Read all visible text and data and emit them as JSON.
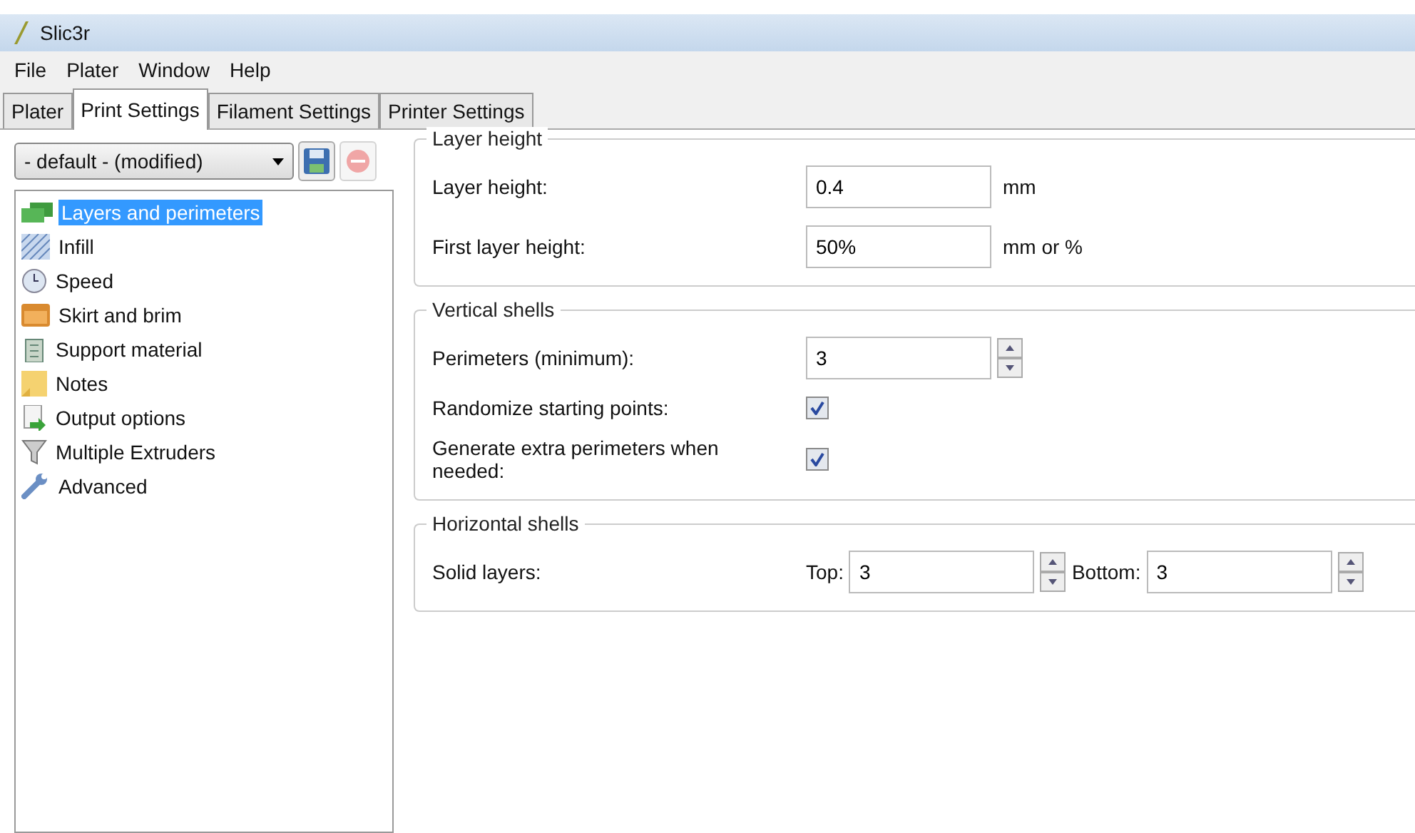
{
  "window": {
    "title": "Slic3r"
  },
  "menu": [
    "File",
    "Plater",
    "Window",
    "Help"
  ],
  "tabs": [
    {
      "label": "Plater",
      "selected": false
    },
    {
      "label": "Print Settings",
      "selected": true
    },
    {
      "label": "Filament Settings",
      "selected": false
    },
    {
      "label": "Printer Settings",
      "selected": false
    }
  ],
  "preset": {
    "value": "- default - (modified)",
    "delete_disabled": true
  },
  "sidebar": {
    "items": [
      {
        "label": "Layers and perimeters",
        "selected": true
      },
      {
        "label": "Infill",
        "selected": false
      },
      {
        "label": "Speed",
        "selected": false
      },
      {
        "label": "Skirt and brim",
        "selected": false
      },
      {
        "label": "Support material",
        "selected": false
      },
      {
        "label": "Notes",
        "selected": false
      },
      {
        "label": "Output options",
        "selected": false
      },
      {
        "label": "Multiple Extruders",
        "selected": false
      },
      {
        "label": "Advanced",
        "selected": false
      }
    ]
  },
  "groups": [
    {
      "title": "Layer height",
      "rows": [
        {
          "kind": "text",
          "label": "Layer height:",
          "value": "0.4",
          "unit": "mm"
        },
        {
          "kind": "text",
          "label": "First layer height:",
          "value": "50%",
          "unit": "mm or %"
        }
      ]
    },
    {
      "title": "Vertical shells",
      "rows": [
        {
          "kind": "spin",
          "label": "Perimeters (minimum):",
          "value": "3"
        },
        {
          "kind": "checkbox",
          "label": "Randomize starting points:",
          "checked": true
        },
        {
          "kind": "checkbox",
          "label": "Generate extra perimeters when needed:",
          "checked": true
        }
      ]
    },
    {
      "title": "Horizontal shells",
      "rows": [
        {
          "kind": "pair",
          "label": "Solid layers:",
          "fields": [
            {
              "label": "Top:",
              "value": "3"
            },
            {
              "label": "Bottom:",
              "value": "3"
            }
          ]
        }
      ]
    }
  ]
}
